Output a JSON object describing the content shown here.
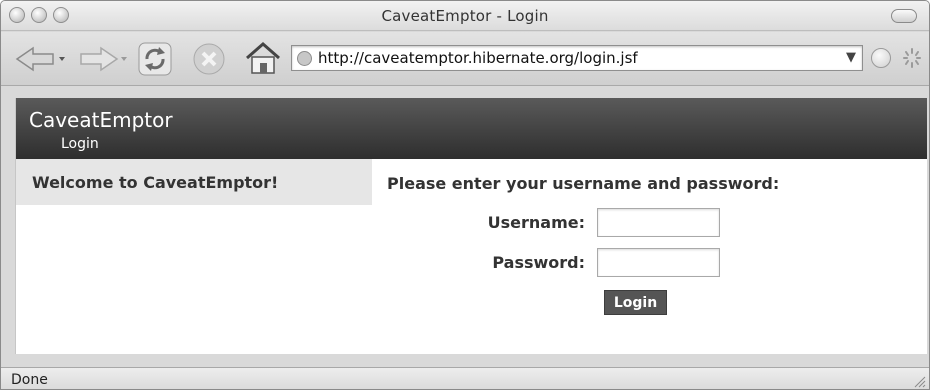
{
  "window": {
    "title": "CaveatEmptor - Login"
  },
  "toolbar": {
    "url": "http://caveatemptor.hibernate.org/login.jsf",
    "icons": [
      "back-icon",
      "forward-icon",
      "reload-icon",
      "stop-icon",
      "home-icon",
      "globe-icon",
      "go-icon",
      "spinner-icon"
    ]
  },
  "site": {
    "name": "CaveatEmptor",
    "subtitle": "Login"
  },
  "sidebar": {
    "title": "Welcome to CaveatEmptor!"
  },
  "main": {
    "title": "Please enter your username and password:",
    "username_label": "Username:",
    "password_label": "Password:",
    "username_value": "",
    "password_value": "",
    "login_label": "Login"
  },
  "status": {
    "text": "Done"
  },
  "colors": {
    "header_dark": "#2e2e2e",
    "sidebar_bg": "#e6e6e6",
    "button_bg": "#555555"
  }
}
